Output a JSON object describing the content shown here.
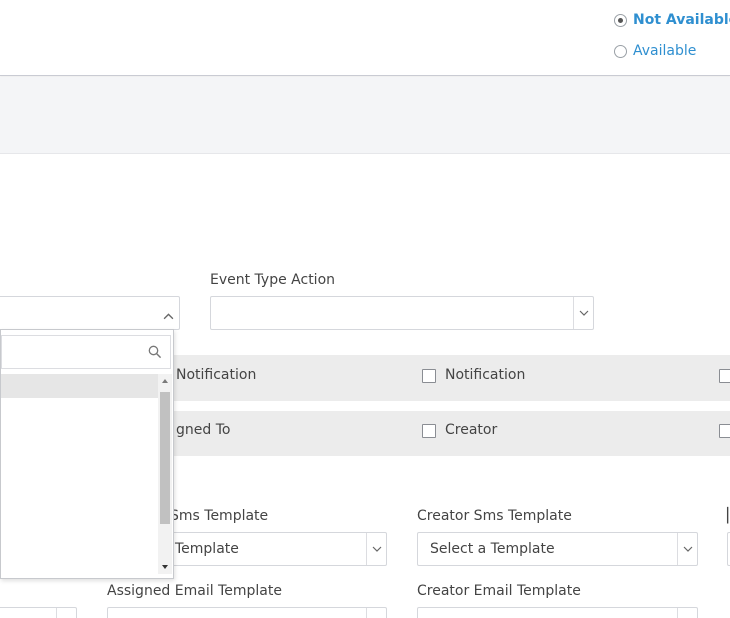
{
  "availability": {
    "options": [
      {
        "label": "Not Available",
        "selected": true
      },
      {
        "label": "Available",
        "selected": false
      }
    ]
  },
  "form": {
    "event_type_action": {
      "label": "Event Type Action",
      "value": ""
    },
    "notification_row": {
      "partial_label": "Notification",
      "creator_label": "Notification"
    },
    "recipient_row": {
      "partial_label": "gned To",
      "creator_label": "Creator"
    },
    "sms": {
      "assigned_label_partial": "Sms Template",
      "assigned_value_partial": "Template",
      "creator_label": "Creator Sms Template",
      "creator_value": "Select a Template"
    },
    "email": {
      "assigned_label": "Assigned Email Template",
      "creator_label": "Creator Email Template"
    }
  },
  "dropdown": {
    "search_value": "",
    "options": [
      "",
      "",
      "",
      "",
      "",
      "",
      "",
      ""
    ]
  },
  "colors": {
    "link_blue": "#2f8fd0",
    "band_gray": "#ececec",
    "header_band": "#f4f5f7"
  }
}
